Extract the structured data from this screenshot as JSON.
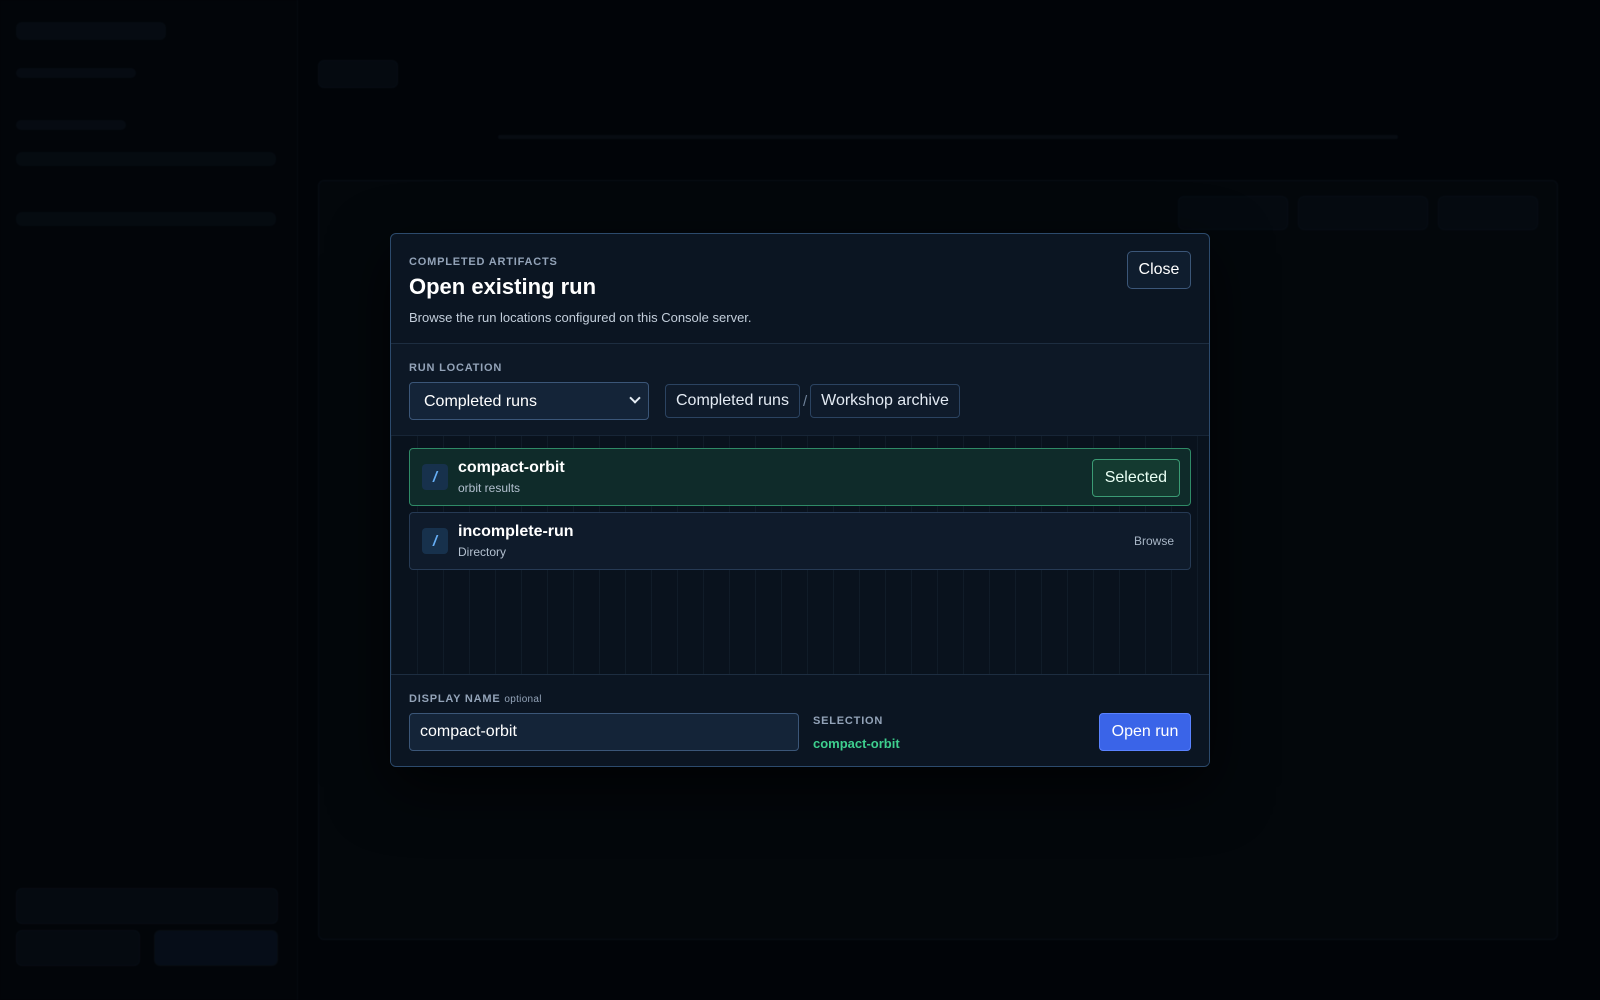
{
  "modal": {
    "eyebrow": "COMPLETED ARTIFACTS",
    "title": "Open existing run",
    "subtitle": "Browse the run locations configured on this Console server.",
    "close_label": "Close"
  },
  "location": {
    "label": "RUN LOCATION",
    "selected": "Completed runs",
    "options": [
      "Completed runs"
    ],
    "breadcrumb": [
      "Completed runs",
      "Workshop archive"
    ],
    "separator": "/"
  },
  "runs": [
    {
      "name": "compact-orbit",
      "meta": "orbit results",
      "action": "Selected",
      "selected": true
    },
    {
      "name": "incomplete-run",
      "meta": "Directory",
      "action": "Browse",
      "selected": false
    }
  ],
  "footer": {
    "display_label": "DISPLAY NAME",
    "display_optional": "optional",
    "display_value": "compact-orbit",
    "selection_label": "SELECTION",
    "selection_value": "compact-orbit",
    "open_label": "Open run"
  },
  "icons": {
    "folder": "folder-icon",
    "chevron": "chevron-down-icon"
  },
  "colors": {
    "accent": "#3a64e8",
    "success": "#3ecf8e",
    "selected_bg": "#0f2b2a"
  }
}
